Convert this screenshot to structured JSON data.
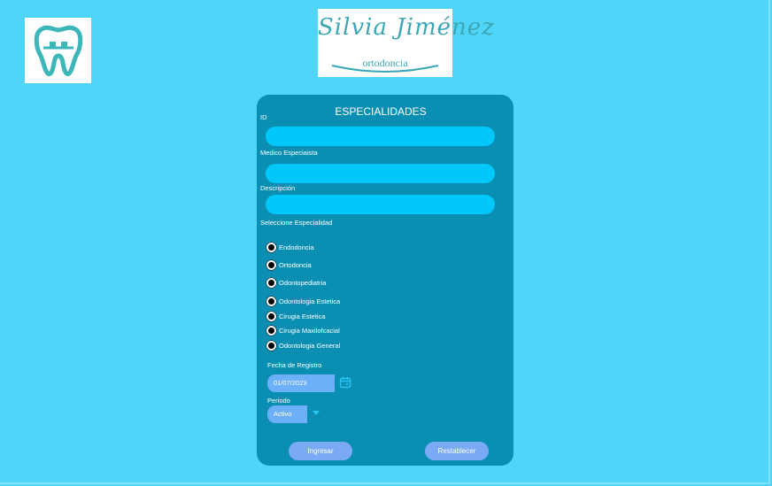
{
  "brand": {
    "name": "Silvia Jiménez",
    "subtitle": "ortodoncia"
  },
  "icons": {
    "logo": "tooth-braces-icon",
    "calendar": "calendar-icon",
    "dropdown": "caret-down-icon"
  },
  "colors": {
    "background": "#4fd5f7",
    "panel": "#0a8fb3",
    "field": "#00c8fb",
    "button": "#7aa9f5"
  },
  "form": {
    "title": "ESPECIALIDADES",
    "id_label": "ID",
    "id_value": "",
    "medico_label": "Medico Especiaista",
    "medico_value": "",
    "descripcion_label": "Descripción",
    "descripcion_value": "",
    "especialidad_label": "Seleccione Especialidad",
    "especialidades": [
      "Endodoncia",
      "Ortodoncia",
      "Odontopediatria",
      "Odontologia Estetica",
      "Cirugia Estetica",
      "Cirugia Maxilofcacial",
      "Odontologia General"
    ],
    "fecha_label": "Fecha de Registro",
    "fecha_value": "01/07/2023",
    "periodo_label": "Periodo",
    "periodo_value": "Activo",
    "ingresar_label": "Ingresar",
    "restablecer_label": "Restablecer"
  }
}
